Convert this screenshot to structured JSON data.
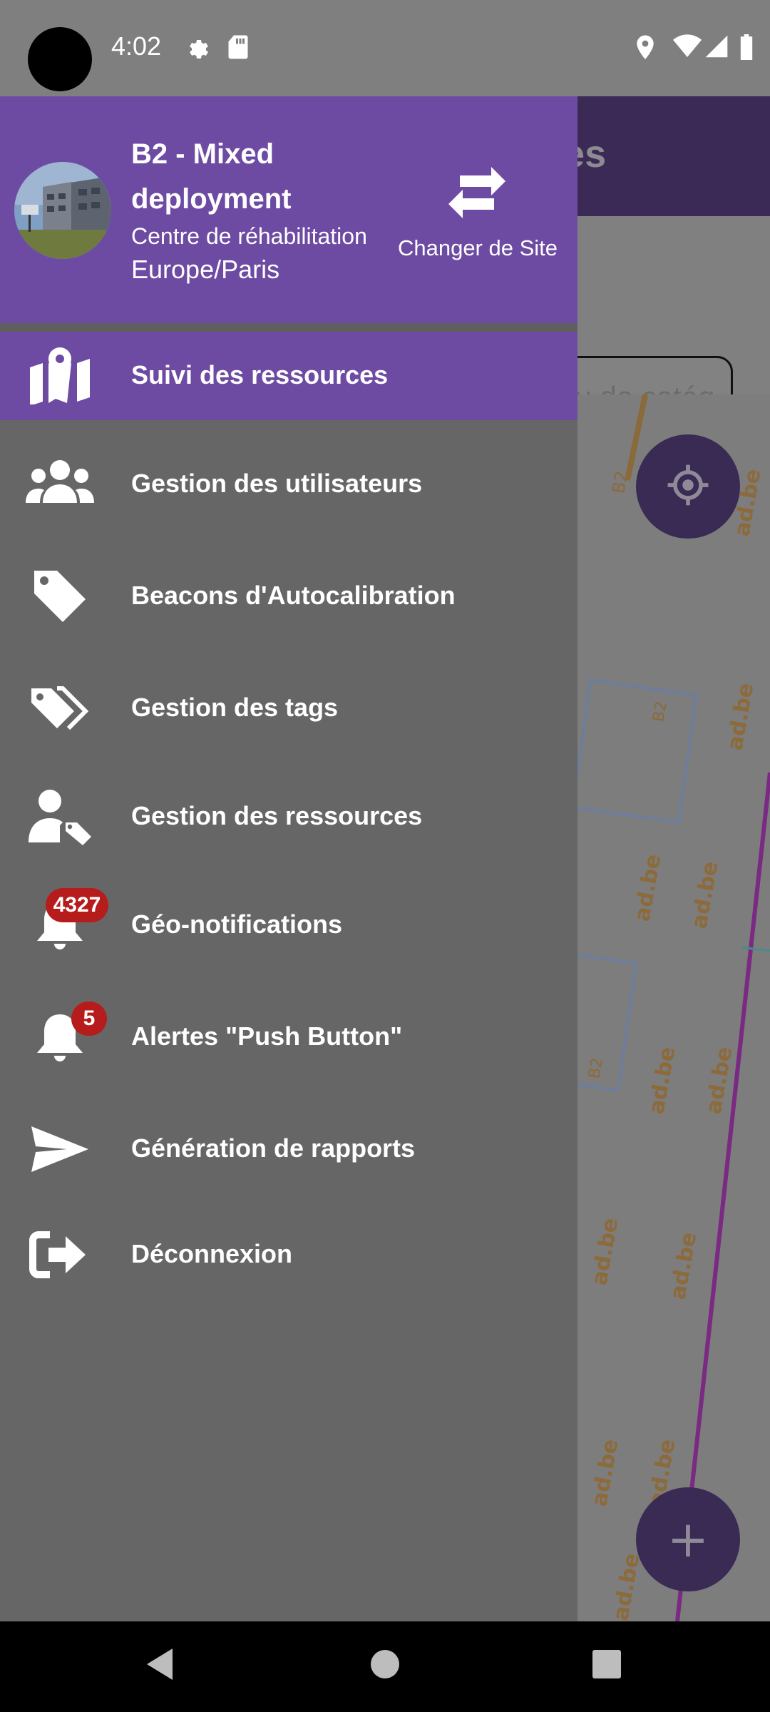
{
  "status_bar": {
    "time": "4:02",
    "icons": [
      "settings-icon",
      "sd-card-icon",
      "location-icon",
      "wifi-icon",
      "signal-icon",
      "battery-icon"
    ]
  },
  "background_app": {
    "title_fragment": "ces",
    "search_placeholder": "ou de catég"
  },
  "drawer": {
    "header": {
      "site_name": "B2 - Mixed deployment",
      "site_subtitle": "Centre de réhabilitation",
      "timezone": "Europe/Paris",
      "change_site_label": "Changer de Site",
      "colors": {
        "header_bg": "#6e4ba3",
        "drawer_bg": "#666666"
      }
    },
    "items": [
      {
        "label": "Suivi des ressources",
        "icon": "map-pin-icon",
        "active": true
      },
      {
        "label": "Gestion des utilisateurs",
        "icon": "users-icon"
      },
      {
        "label": "Beacons d'Autocalibration",
        "icon": "tag-icon"
      },
      {
        "label": "Gestion des tags",
        "icon": "tags-icon"
      },
      {
        "label": "Gestion des ressources",
        "icon": "user-tag-icon"
      },
      {
        "label": "Géo-notifications",
        "icon": "bell-icon",
        "badge": "4327"
      },
      {
        "label": "Alertes \"Push Button\"",
        "icon": "bell-icon",
        "badge": "5"
      },
      {
        "label": "Génération de rapports",
        "icon": "send-icon"
      },
      {
        "label": "Déconnexion",
        "icon": "logout-icon"
      }
    ]
  },
  "fabs": {
    "locate": "crosshairs-icon",
    "add": "+"
  },
  "nav_bar": [
    "back-icon",
    "home-icon",
    "recents-icon"
  ]
}
